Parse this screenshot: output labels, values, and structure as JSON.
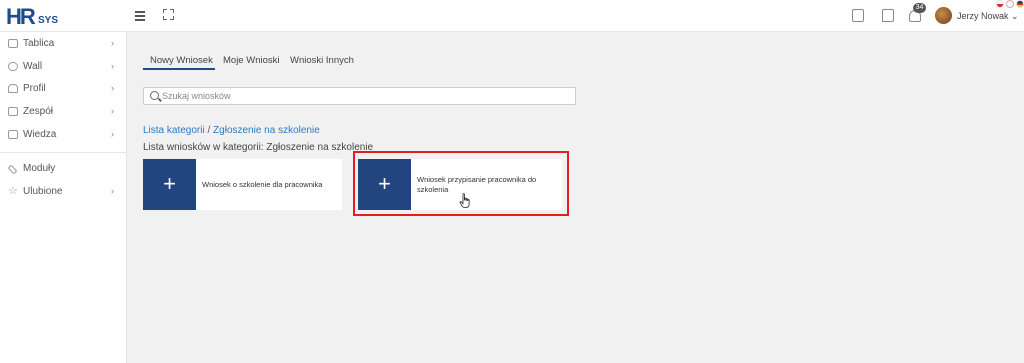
{
  "brand": {
    "logo_main": "HR",
    "logo_sub": "SYS",
    "brand_color": "#1f4a8c"
  },
  "header": {
    "notification_count": "34",
    "user_name": "Jerzy Nowak",
    "languages": [
      "pl",
      "en",
      "de"
    ]
  },
  "sidebar": {
    "items": [
      {
        "label": "Tablica",
        "icon": "monitor-icon",
        "chevron": "›"
      },
      {
        "label": "Wall",
        "icon": "chat-bubble-icon",
        "chevron": "›"
      },
      {
        "label": "Profil",
        "icon": "user-icon",
        "chevron": "›"
      },
      {
        "label": "Zespół",
        "icon": "team-icon",
        "chevron": "›"
      },
      {
        "label": "Wiedza",
        "icon": "book-icon",
        "chevron": "›"
      },
      {
        "label": "Moduły",
        "icon": "wrench-icon",
        "chevron": ""
      },
      {
        "label": "Ulubione",
        "icon": "star-icon",
        "chevron": "›"
      }
    ]
  },
  "tabs": [
    {
      "label": "Nowy Wniosek",
      "active": true
    },
    {
      "label": "Moje Wnioski",
      "active": false
    },
    {
      "label": "Wnioski Innych",
      "active": false
    }
  ],
  "search": {
    "placeholder": "Szukaj wniosków",
    "value": ""
  },
  "breadcrumb": {
    "root": "Lista kategorii",
    "separator": "/",
    "current": "Zgłoszenie na szkolenie"
  },
  "subtitle": "Lista wniosków w kategorii: Zgłoszenie na szkolenie",
  "cards": [
    {
      "plus": "+",
      "title": "Wniosek o szkolenie dla pracownika"
    },
    {
      "plus": "+",
      "title_line1": "Wniosek przypisanie pracownika do",
      "title_line2": "szkolenia"
    }
  ],
  "colors": {
    "accent": "#22457f",
    "link": "#2a7ac7",
    "highlight": "#e02020"
  }
}
